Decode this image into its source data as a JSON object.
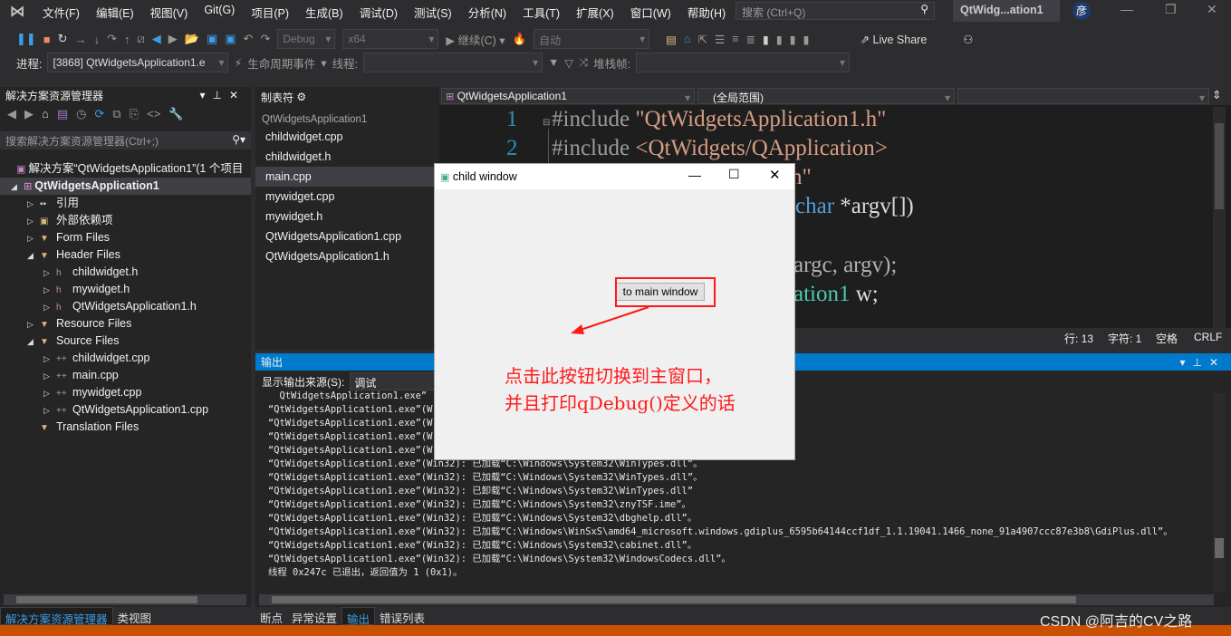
{
  "menu": {
    "items": [
      "文件(F)",
      "编辑(E)",
      "视图(V)",
      "Git(G)",
      "项目(P)",
      "生成(B)",
      "调试(D)",
      "测试(S)",
      "分析(N)",
      "工具(T)",
      "扩展(X)",
      "窗口(W)",
      "帮助(H)"
    ],
    "search_placeholder": "搜索 (Ctrl+Q)",
    "solution_title": "QtWidg...ation1",
    "avatar": "彦"
  },
  "toolbar": {
    "config": "Debug",
    "platform": "x64",
    "continue": "继续(C)",
    "auto": "自动",
    "live_share": "Live Share"
  },
  "toolbar2": {
    "process_label": "进程:",
    "process_value": "[3868] QtWidgetsApplication1.e",
    "lifecycle": "生命周期事件",
    "thread_label": "线程:",
    "stack_label": "堆栈帧:"
  },
  "solution_explorer": {
    "title": "解决方案资源管理器",
    "search_placeholder": "搜索解决方案资源管理器(Ctrl+;)",
    "solution": "解决方案“QtWidgetsApplication1”(1 个项目",
    "project": "QtWidgetsApplication1",
    "items": [
      {
        "label": "引用",
        "indent": 1,
        "type": "ref",
        "expand": "closed"
      },
      {
        "label": "外部依赖项",
        "indent": 1,
        "type": "folder",
        "expand": "closed"
      },
      {
        "label": "Form Files",
        "indent": 1,
        "type": "filter",
        "expand": "closed"
      },
      {
        "label": "Header Files",
        "indent": 1,
        "type": "filter",
        "expand": "open"
      },
      {
        "label": "childwidget.h",
        "indent": 2,
        "type": "h",
        "expand": "closed"
      },
      {
        "label": "mywidget.h",
        "indent": 2,
        "type": "h",
        "expand": "closed"
      },
      {
        "label": "QtWidgetsApplication1.h",
        "indent": 2,
        "type": "h",
        "expand": "closed"
      },
      {
        "label": "Resource Files",
        "indent": 1,
        "type": "filter",
        "expand": "closed"
      },
      {
        "label": "Source Files",
        "indent": 1,
        "type": "filter",
        "expand": "open"
      },
      {
        "label": "childwidget.cpp",
        "indent": 2,
        "type": "cpp",
        "expand": "closed"
      },
      {
        "label": "main.cpp",
        "indent": 2,
        "type": "cpp",
        "expand": "closed"
      },
      {
        "label": "mywidget.cpp",
        "indent": 2,
        "type": "cpp",
        "expand": "closed"
      },
      {
        "label": "QtWidgetsApplication1.cpp",
        "indent": 2,
        "type": "cpp",
        "expand": "closed"
      },
      {
        "label": "Translation Files",
        "indent": 1,
        "type": "filter",
        "expand": "none"
      }
    ]
  },
  "tabs_panel": {
    "title": "制表符",
    "group": "QtWidgetsApplication1",
    "files": [
      "childwidget.cpp",
      "childwidget.h",
      "main.cpp",
      "mywidget.cpp",
      "mywidget.h",
      "QtWidgetsApplication1.cpp",
      "QtWidgetsApplication1.h"
    ],
    "selected": "main.cpp"
  },
  "editor": {
    "nav_project": "QtWidgetsApplication1",
    "nav_scope": "(全局范围)",
    "line_numbers": [
      "1",
      "2"
    ],
    "line1_kw": "#include ",
    "line1_str": "\"QtWidgetsApplication1.h\"",
    "line2_kw": "#include ",
    "line2_str": "<QtWidgets/QApplication>",
    "line3_frag": "h\"",
    "line4_ty": "char",
    "line4_txt": " *argv[])",
    "line6_frag": "argc, argv);",
    "line7_cls": "ation1",
    "line7_txt": " w;",
    "status": {
      "line": "行: 13",
      "char": "字符: 1",
      "spaces": "空格",
      "eol": "CRLF"
    }
  },
  "output": {
    "title": "输出",
    "source_label": "显示输出来源(S):",
    "source_value": "调试",
    "lines": [
      "  QtWidgetsApplication1.exe” (W",
      "“QtWidgetsApplication1.exe”(W",
      "“QtWidgetsApplication1.exe”(W",
      "“QtWidgetsApplication1.exe”(W",
      "“QtWidgetsApplication1.exe”(W",
      "“QtWidgetsApplication1.exe”(Win32): 已加载“C:\\Windows\\System32\\WinTypes.dll”。",
      "“QtWidgetsApplication1.exe”(Win32): 已加载“C:\\Windows\\System32\\WinTypes.dll”。",
      "“QtWidgetsApplication1.exe”(Win32): 已卸载“C:\\Windows\\System32\\WinTypes.dll”",
      "“QtWidgetsApplication1.exe”(Win32): 已加载“C:\\Windows\\System32\\znyTSF.ime”。",
      "“QtWidgetsApplication1.exe”(Win32): 已加载“C:\\Windows\\System32\\dbghelp.dll”。",
      "“QtWidgetsApplication1.exe”(Win32): 已加载“C:\\Windows\\WinSxS\\amd64_microsoft.windows.gdiplus_6595b64144ccf1df_1.1.19041.1466_none_91a4907ccc87e3b8\\GdiPlus.dll”。",
      "“QtWidgetsApplication1.exe”(Win32): 已加载“C:\\Windows\\System32\\cabinet.dll”。",
      "“QtWidgetsApplication1.exe”(Win32): 已加载“C:\\Windows\\System32\\WindowsCodecs.dll”。",
      "线程 0x247c 已退出，返回值为 1 (0x1)。"
    ]
  },
  "bottom_tabs_left": [
    "解决方案资源管理器",
    "类视图"
  ],
  "bottom_tabs_right": [
    "断点",
    "异常设置",
    "输出",
    "错误列表"
  ],
  "child_window": {
    "title": "child window",
    "button": "to main window"
  },
  "annotation": {
    "line1": "点击此按钮切换到主窗口，",
    "line2": "并且打印qDebug()定义的话"
  },
  "watermark": "CSDN @阿吉的CV之路",
  "colors": {
    "accent": "#007acc",
    "status_bar": "#ca5100",
    "annotation": "#ff1a1a"
  }
}
